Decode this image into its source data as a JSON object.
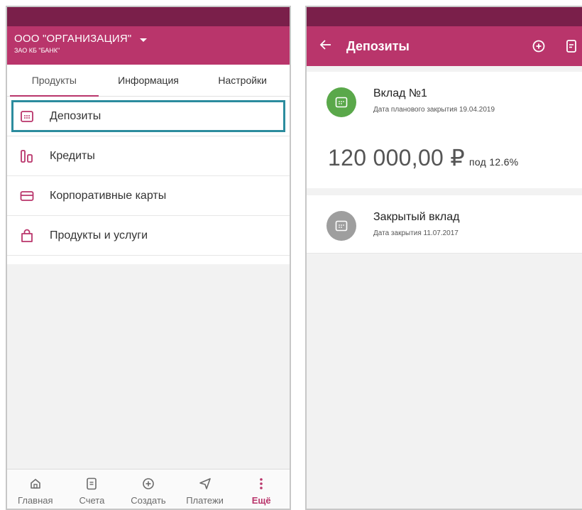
{
  "left": {
    "org_name": "ООО \"ОРГАНИЗАЦИЯ\"",
    "org_sub": "ЗАО КБ \"БАНК\"",
    "tabs": [
      {
        "label": "Продукты"
      },
      {
        "label": "Информация"
      },
      {
        "label": "Настройки"
      }
    ],
    "menu": [
      {
        "label": "Депозиты",
        "icon": "deposit-icon"
      },
      {
        "label": "Кредиты",
        "icon": "credit-icon"
      },
      {
        "label": "Корпоративные карты",
        "icon": "card-icon"
      },
      {
        "label": "Продукты и услуги",
        "icon": "bag-icon"
      }
    ],
    "bottom_nav": [
      {
        "label": "Главная",
        "icon": "home-icon"
      },
      {
        "label": "Счета",
        "icon": "document-icon"
      },
      {
        "label": "Создать",
        "icon": "plus-circle-icon"
      },
      {
        "label": "Платежи",
        "icon": "send-icon"
      },
      {
        "label": "Ещё",
        "icon": "more-vertical-icon",
        "active": true
      }
    ]
  },
  "right": {
    "title": "Депозиты",
    "deposits": [
      {
        "title": "Вклад №1",
        "subtitle": "Дата планового закрытия 19.04.2019",
        "amount": "120 000,00 ₽",
        "rate": "под 12.6%"
      },
      {
        "title": "Закрытый вклад",
        "subtitle": "Дата закрытия 11.07.2017"
      }
    ]
  },
  "colors": {
    "brand": "#b9356b",
    "status_bar": "#7a1f4a",
    "active_deposit": "#5aa84a",
    "closed_deposit": "#9e9e9e",
    "highlight": "#2c8c9e"
  }
}
